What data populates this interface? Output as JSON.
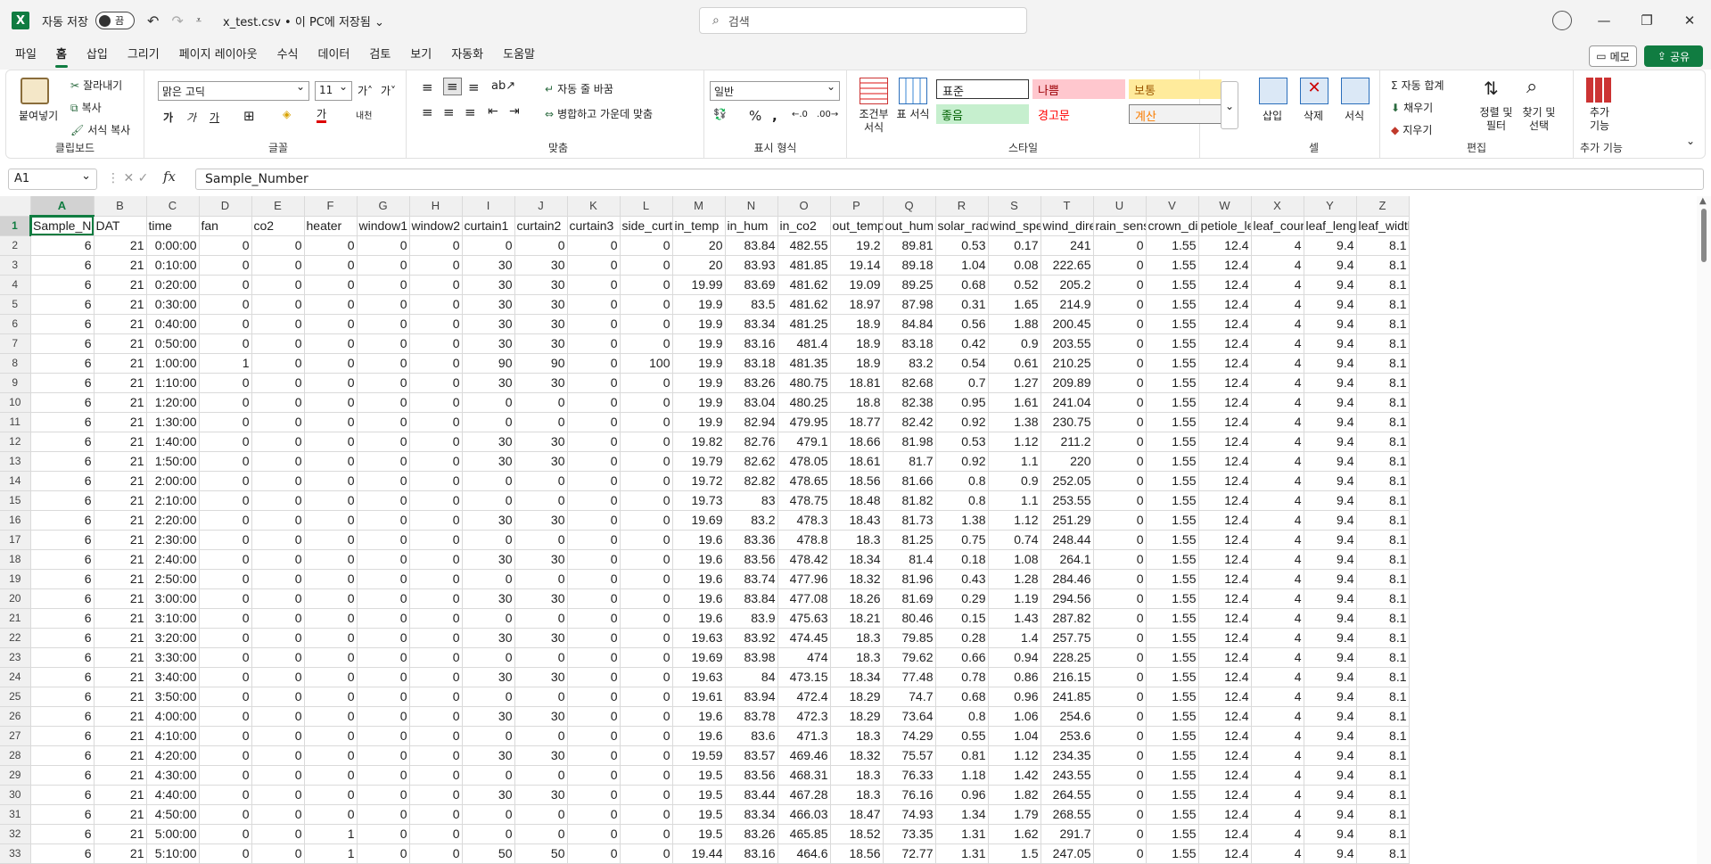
{
  "titlebar": {
    "app_icon": "X",
    "autosave_label": "자동 저장",
    "toggle_state": "끔",
    "filename": "x_test.csv • 이 PC에 저장됨 ⌄",
    "search_placeholder": "검색"
  },
  "menu": {
    "tabs": [
      "파일",
      "홈",
      "삽입",
      "그리기",
      "페이지 레이아웃",
      "수식",
      "데이터",
      "검토",
      "보기",
      "자동화",
      "도움말"
    ],
    "active_tab": "홈",
    "memo_label": "메모",
    "share_label": "공유"
  },
  "ribbon": {
    "clipboard": {
      "label": "클립보드",
      "paste": "붙여넣기",
      "cut": "잘라내기",
      "copy": "복사",
      "format_painter": "서식 복사"
    },
    "font": {
      "label": "글꼴",
      "font_name": "맑은 고딕",
      "font_size": "11"
    },
    "alignment": {
      "label": "맞춤",
      "wrap_text": "자동 줄 바꿈",
      "merge_center": "병합하고 가운데 맞춤"
    },
    "number": {
      "label": "표시 형식",
      "format": "일반"
    },
    "styles": {
      "label": "스타일",
      "conditional": "조건부 서식",
      "table": "표 서식",
      "cells": [
        "표준",
        "나쁨",
        "보통",
        "좋음",
        "경고문",
        "계산"
      ]
    },
    "cells": {
      "label": "셀",
      "insert": "삽입",
      "delete": "삭제",
      "format": "서식"
    },
    "editing": {
      "label": "편집",
      "autosum": "자동 합계",
      "fill": "채우기",
      "clear": "지우기",
      "sort": "정렬 및 필터",
      "find": "찾기 및 선택"
    },
    "addins": {
      "label": "추가 기능",
      "button": "추가 기능"
    }
  },
  "formula_bar": {
    "name_box": "A1",
    "fx": "fx",
    "content": "Sample_Number"
  },
  "sheet": {
    "columns": [
      "A",
      "B",
      "C",
      "D",
      "E",
      "F",
      "G",
      "H",
      "I",
      "J",
      "K",
      "L",
      "M",
      "N",
      "O",
      "P",
      "Q",
      "R",
      "S",
      "T",
      "U",
      "V",
      "W",
      "X",
      "Y",
      "Z"
    ],
    "header_row": [
      "Sample_N",
      "DAT",
      "time",
      "fan",
      "co2",
      "heater",
      "window1",
      "window2",
      "curtain1",
      "curtain2",
      "curtain3",
      "side_curta",
      "in_temp",
      "in_hum",
      "in_co2",
      "out_temp",
      "out_hum",
      "solar_rad",
      "wind_spee",
      "wind_direc",
      "rain_senso",
      "crown_dia",
      "petiole_ler",
      "leaf_count",
      "leaf_lengtl",
      "leaf_widtl"
    ],
    "rows": [
      [
        "6",
        "21",
        "0:00:00",
        "0",
        "0",
        "0",
        "0",
        "0",
        "0",
        "0",
        "0",
        "0",
        "20",
        "83.84",
        "482.55",
        "19.2",
        "89.81",
        "0.53",
        "0.17",
        "241",
        "0",
        "1.55",
        "12.4",
        "4",
        "9.4",
        "8.1"
      ],
      [
        "6",
        "21",
        "0:10:00",
        "0",
        "0",
        "0",
        "0",
        "0",
        "30",
        "30",
        "0",
        "0",
        "20",
        "83.93",
        "481.85",
        "19.14",
        "89.18",
        "1.04",
        "0.08",
        "222.65",
        "0",
        "1.55",
        "12.4",
        "4",
        "9.4",
        "8.1"
      ],
      [
        "6",
        "21",
        "0:20:00",
        "0",
        "0",
        "0",
        "0",
        "0",
        "30",
        "30",
        "0",
        "0",
        "19.99",
        "83.69",
        "481.62",
        "19.09",
        "89.25",
        "0.68",
        "0.52",
        "205.2",
        "0",
        "1.55",
        "12.4",
        "4",
        "9.4",
        "8.1"
      ],
      [
        "6",
        "21",
        "0:30:00",
        "0",
        "0",
        "0",
        "0",
        "0",
        "30",
        "30",
        "0",
        "0",
        "19.9",
        "83.5",
        "481.62",
        "18.97",
        "87.98",
        "0.31",
        "1.65",
        "214.9",
        "0",
        "1.55",
        "12.4",
        "4",
        "9.4",
        "8.1"
      ],
      [
        "6",
        "21",
        "0:40:00",
        "0",
        "0",
        "0",
        "0",
        "0",
        "30",
        "30",
        "0",
        "0",
        "19.9",
        "83.34",
        "481.25",
        "18.9",
        "84.84",
        "0.56",
        "1.88",
        "200.45",
        "0",
        "1.55",
        "12.4",
        "4",
        "9.4",
        "8.1"
      ],
      [
        "6",
        "21",
        "0:50:00",
        "0",
        "0",
        "0",
        "0",
        "0",
        "30",
        "30",
        "0",
        "0",
        "19.9",
        "83.16",
        "481.4",
        "18.9",
        "83.18",
        "0.42",
        "0.9",
        "203.55",
        "0",
        "1.55",
        "12.4",
        "4",
        "9.4",
        "8.1"
      ],
      [
        "6",
        "21",
        "1:00:00",
        "1",
        "0",
        "0",
        "0",
        "0",
        "90",
        "90",
        "0",
        "100",
        "19.9",
        "83.18",
        "481.35",
        "18.9",
        "83.2",
        "0.54",
        "0.61",
        "210.25",
        "0",
        "1.55",
        "12.4",
        "4",
        "9.4",
        "8.1"
      ],
      [
        "6",
        "21",
        "1:10:00",
        "0",
        "0",
        "0",
        "0",
        "0",
        "30",
        "30",
        "0",
        "0",
        "19.9",
        "83.26",
        "480.75",
        "18.81",
        "82.68",
        "0.7",
        "1.27",
        "209.89",
        "0",
        "1.55",
        "12.4",
        "4",
        "9.4",
        "8.1"
      ],
      [
        "6",
        "21",
        "1:20:00",
        "0",
        "0",
        "0",
        "0",
        "0",
        "0",
        "0",
        "0",
        "0",
        "19.9",
        "83.04",
        "480.25",
        "18.8",
        "82.38",
        "0.95",
        "1.61",
        "241.04",
        "0",
        "1.55",
        "12.4",
        "4",
        "9.4",
        "8.1"
      ],
      [
        "6",
        "21",
        "1:30:00",
        "0",
        "0",
        "0",
        "0",
        "0",
        "0",
        "0",
        "0",
        "0",
        "19.9",
        "82.94",
        "479.95",
        "18.77",
        "82.42",
        "0.92",
        "1.38",
        "230.75",
        "0",
        "1.55",
        "12.4",
        "4",
        "9.4",
        "8.1"
      ],
      [
        "6",
        "21",
        "1:40:00",
        "0",
        "0",
        "0",
        "0",
        "0",
        "30",
        "30",
        "0",
        "0",
        "19.82",
        "82.76",
        "479.1",
        "18.66",
        "81.98",
        "0.53",
        "1.12",
        "211.2",
        "0",
        "1.55",
        "12.4",
        "4",
        "9.4",
        "8.1"
      ],
      [
        "6",
        "21",
        "1:50:00",
        "0",
        "0",
        "0",
        "0",
        "0",
        "30",
        "30",
        "0",
        "0",
        "19.79",
        "82.62",
        "478.05",
        "18.61",
        "81.7",
        "0.92",
        "1.1",
        "220",
        "0",
        "1.55",
        "12.4",
        "4",
        "9.4",
        "8.1"
      ],
      [
        "6",
        "21",
        "2:00:00",
        "0",
        "0",
        "0",
        "0",
        "0",
        "0",
        "0",
        "0",
        "0",
        "19.72",
        "82.82",
        "478.65",
        "18.56",
        "81.66",
        "0.8",
        "0.9",
        "252.05",
        "0",
        "1.55",
        "12.4",
        "4",
        "9.4",
        "8.1"
      ],
      [
        "6",
        "21",
        "2:10:00",
        "0",
        "0",
        "0",
        "0",
        "0",
        "0",
        "0",
        "0",
        "0",
        "19.73",
        "83",
        "478.75",
        "18.48",
        "81.82",
        "0.8",
        "1.1",
        "253.55",
        "0",
        "1.55",
        "12.4",
        "4",
        "9.4",
        "8.1"
      ],
      [
        "6",
        "21",
        "2:20:00",
        "0",
        "0",
        "0",
        "0",
        "0",
        "30",
        "30",
        "0",
        "0",
        "19.69",
        "83.2",
        "478.3",
        "18.43",
        "81.73",
        "1.38",
        "1.12",
        "251.29",
        "0",
        "1.55",
        "12.4",
        "4",
        "9.4",
        "8.1"
      ],
      [
        "6",
        "21",
        "2:30:00",
        "0",
        "0",
        "0",
        "0",
        "0",
        "0",
        "0",
        "0",
        "0",
        "19.6",
        "83.36",
        "478.8",
        "18.3",
        "81.25",
        "0.75",
        "0.74",
        "248.44",
        "0",
        "1.55",
        "12.4",
        "4",
        "9.4",
        "8.1"
      ],
      [
        "6",
        "21",
        "2:40:00",
        "0",
        "0",
        "0",
        "0",
        "0",
        "30",
        "30",
        "0",
        "0",
        "19.6",
        "83.56",
        "478.42",
        "18.34",
        "81.4",
        "0.18",
        "1.08",
        "264.1",
        "0",
        "1.55",
        "12.4",
        "4",
        "9.4",
        "8.1"
      ],
      [
        "6",
        "21",
        "2:50:00",
        "0",
        "0",
        "0",
        "0",
        "0",
        "0",
        "0",
        "0",
        "0",
        "19.6",
        "83.74",
        "477.96",
        "18.32",
        "81.96",
        "0.43",
        "1.28",
        "284.46",
        "0",
        "1.55",
        "12.4",
        "4",
        "9.4",
        "8.1"
      ],
      [
        "6",
        "21",
        "3:00:00",
        "0",
        "0",
        "0",
        "0",
        "0",
        "30",
        "30",
        "0",
        "0",
        "19.6",
        "83.84",
        "477.08",
        "18.26",
        "81.69",
        "0.29",
        "1.19",
        "294.56",
        "0",
        "1.55",
        "12.4",
        "4",
        "9.4",
        "8.1"
      ],
      [
        "6",
        "21",
        "3:10:00",
        "0",
        "0",
        "0",
        "0",
        "0",
        "0",
        "0",
        "0",
        "0",
        "19.6",
        "83.9",
        "475.63",
        "18.21",
        "80.46",
        "0.15",
        "1.43",
        "287.82",
        "0",
        "1.55",
        "12.4",
        "4",
        "9.4",
        "8.1"
      ],
      [
        "6",
        "21",
        "3:20:00",
        "0",
        "0",
        "0",
        "0",
        "0",
        "30",
        "30",
        "0",
        "0",
        "19.63",
        "83.92",
        "474.45",
        "18.3",
        "79.85",
        "0.28",
        "1.4",
        "257.75",
        "0",
        "1.55",
        "12.4",
        "4",
        "9.4",
        "8.1"
      ],
      [
        "6",
        "21",
        "3:30:00",
        "0",
        "0",
        "0",
        "0",
        "0",
        "0",
        "0",
        "0",
        "0",
        "19.69",
        "83.98",
        "474",
        "18.3",
        "79.62",
        "0.66",
        "0.94",
        "228.25",
        "0",
        "1.55",
        "12.4",
        "4",
        "9.4",
        "8.1"
      ],
      [
        "6",
        "21",
        "3:40:00",
        "0",
        "0",
        "0",
        "0",
        "0",
        "30",
        "30",
        "0",
        "0",
        "19.63",
        "84",
        "473.15",
        "18.34",
        "77.48",
        "0.78",
        "0.86",
        "216.15",
        "0",
        "1.55",
        "12.4",
        "4",
        "9.4",
        "8.1"
      ],
      [
        "6",
        "21",
        "3:50:00",
        "0",
        "0",
        "0",
        "0",
        "0",
        "0",
        "0",
        "0",
        "0",
        "19.61",
        "83.94",
        "472.4",
        "18.29",
        "74.7",
        "0.68",
        "0.96",
        "241.85",
        "0",
        "1.55",
        "12.4",
        "4",
        "9.4",
        "8.1"
      ],
      [
        "6",
        "21",
        "4:00:00",
        "0",
        "0",
        "0",
        "0",
        "0",
        "30",
        "30",
        "0",
        "0",
        "19.6",
        "83.78",
        "472.3",
        "18.29",
        "73.64",
        "0.8",
        "1.06",
        "254.6",
        "0",
        "1.55",
        "12.4",
        "4",
        "9.4",
        "8.1"
      ],
      [
        "6",
        "21",
        "4:10:00",
        "0",
        "0",
        "0",
        "0",
        "0",
        "0",
        "0",
        "0",
        "0",
        "19.6",
        "83.6",
        "471.3",
        "18.3",
        "74.29",
        "0.55",
        "1.04",
        "253.6",
        "0",
        "1.55",
        "12.4",
        "4",
        "9.4",
        "8.1"
      ],
      [
        "6",
        "21",
        "4:20:00",
        "0",
        "0",
        "0",
        "0",
        "0",
        "30",
        "30",
        "0",
        "0",
        "19.59",
        "83.57",
        "469.46",
        "18.32",
        "75.57",
        "0.81",
        "1.12",
        "234.35",
        "0",
        "1.55",
        "12.4",
        "4",
        "9.4",
        "8.1"
      ],
      [
        "6",
        "21",
        "4:30:00",
        "0",
        "0",
        "0",
        "0",
        "0",
        "0",
        "0",
        "0",
        "0",
        "19.5",
        "83.56",
        "468.31",
        "18.3",
        "76.33",
        "1.18",
        "1.42",
        "243.55",
        "0",
        "1.55",
        "12.4",
        "4",
        "9.4",
        "8.1"
      ],
      [
        "6",
        "21",
        "4:40:00",
        "0",
        "0",
        "0",
        "0",
        "0",
        "30",
        "30",
        "0",
        "0",
        "19.5",
        "83.44",
        "467.28",
        "18.3",
        "76.16",
        "0.96",
        "1.82",
        "264.55",
        "0",
        "1.55",
        "12.4",
        "4",
        "9.4",
        "8.1"
      ],
      [
        "6",
        "21",
        "4:50:00",
        "0",
        "0",
        "0",
        "0",
        "0",
        "0",
        "0",
        "0",
        "0",
        "19.5",
        "83.34",
        "466.03",
        "18.47",
        "74.93",
        "1.34",
        "1.79",
        "268.55",
        "0",
        "1.55",
        "12.4",
        "4",
        "9.4",
        "8.1"
      ],
      [
        "6",
        "21",
        "5:00:00",
        "0",
        "0",
        "1",
        "0",
        "0",
        "0",
        "0",
        "0",
        "0",
        "19.5",
        "83.26",
        "465.85",
        "18.52",
        "73.35",
        "1.31",
        "1.62",
        "291.7",
        "0",
        "1.55",
        "12.4",
        "4",
        "9.4",
        "8.1"
      ],
      [
        "6",
        "21",
        "5:10:00",
        "0",
        "0",
        "1",
        "0",
        "0",
        "50",
        "50",
        "0",
        "0",
        "19.44",
        "83.16",
        "464.6",
        "18.56",
        "72.77",
        "1.31",
        "1.5",
        "247.05",
        "0",
        "1.55",
        "12.4",
        "4",
        "9.4",
        "8.1"
      ]
    ]
  }
}
